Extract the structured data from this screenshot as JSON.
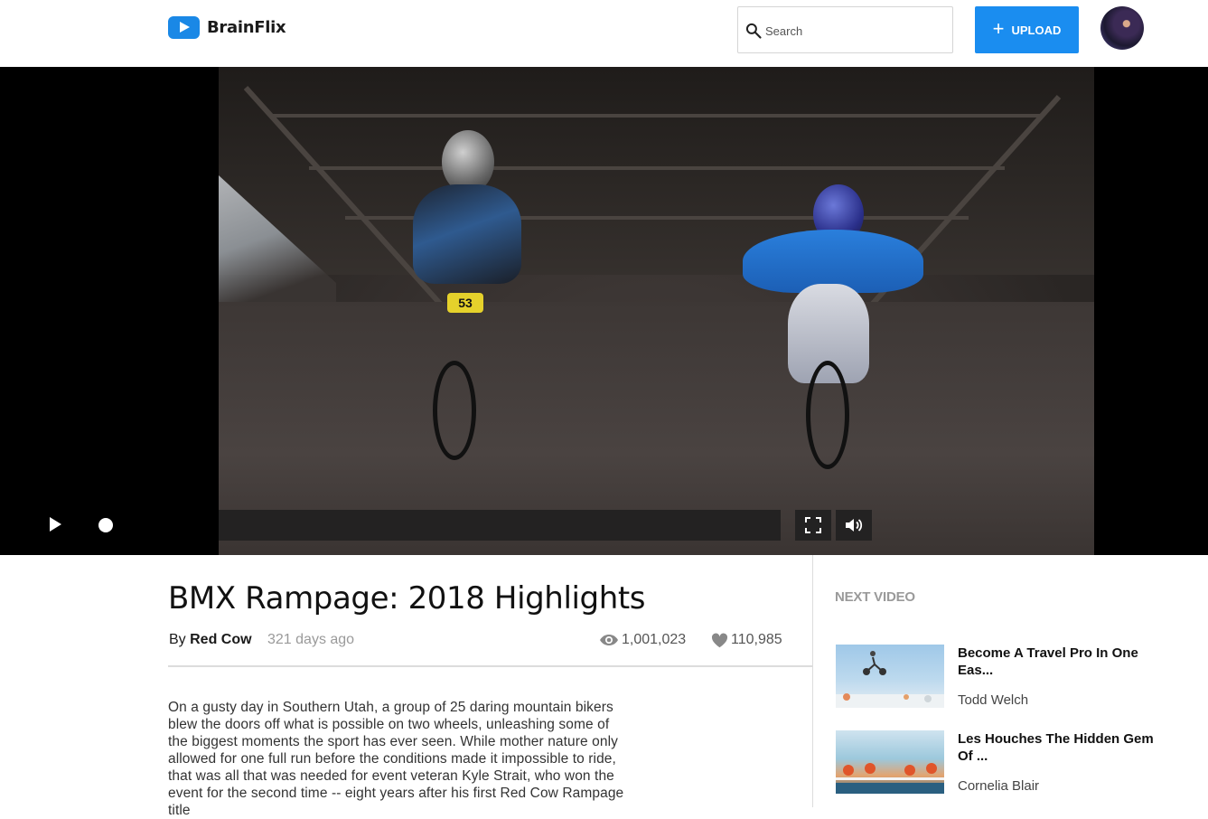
{
  "app": {
    "name": "BrainFlix"
  },
  "search": {
    "placeholder": "Search"
  },
  "upload": {
    "label": "UPLOAD"
  },
  "video": {
    "title": "BMX Rampage: 2018 Highlights",
    "by_prefix": "By",
    "author": "Red Cow",
    "posted": "321 days ago",
    "views": "1,001,023",
    "likes": "110,985",
    "description": "On a gusty day in Southern Utah, a group of 25 daring mountain bikers blew the doors off what is possible on two wheels, unleashing some of the biggest moments the sport has ever seen. While mother nature only allowed for one full run before the conditions made it impossible to ride, that was all that was needed for event veteran Kyle Strait, who won the event for the second time -- eight years after his first Red Cow Rampage title",
    "rider_number": "53"
  },
  "next": {
    "label": "NEXT VIDEO",
    "items": [
      {
        "title": "Become A Travel Pro In One Eas...",
        "author": "Todd Welch"
      },
      {
        "title": "Les Houches The Hidden Gem Of ...",
        "author": "Cornelia Blair"
      }
    ]
  },
  "colors": {
    "accent": "#1a8df0",
    "logo": "#1a88e6"
  }
}
